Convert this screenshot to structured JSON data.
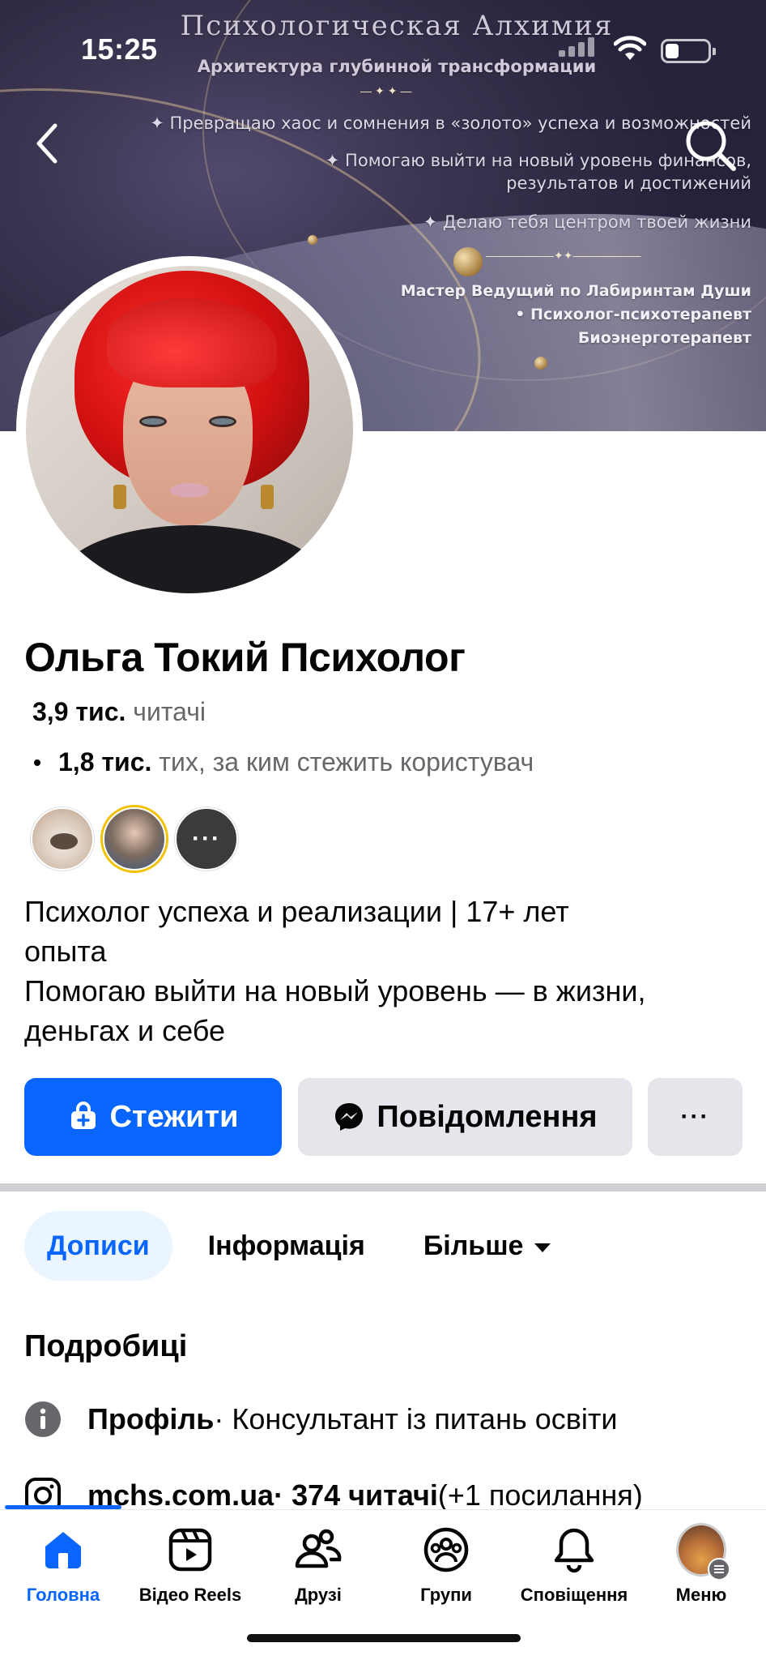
{
  "status_bar": {
    "time": "15:25"
  },
  "cover": {
    "title": "Психологическая Алхимия",
    "subtitle": "Архитектура глубинной трансформации",
    "lines": [
      "✦ Превращаю хаос и сомнения в «золото» успеха и возможностей",
      "✦ Помогаю выйти на новый уровень финансов,",
      "результатов и достижений",
      "✦ Делаю тебя центром твоей жизни"
    ],
    "roles": [
      "Мастер Ведущий по Лабиринтам Души",
      "• Психолог-психотерапевт",
      "Биоэнерготерапевт"
    ],
    "colors": {
      "background": "#2f2a45",
      "gold": "#d9b877"
    }
  },
  "profile": {
    "name": "Ольга Токий Психолог",
    "followers_count": "3,9 тис.",
    "followers_label": "читачі",
    "following_count": "1,8 тис.",
    "following_label": "тих, за ким стежить користувач",
    "follower_avatars": [
      "cat-avatar",
      "woman-avatar",
      "more"
    ],
    "more_avatars_label": "···",
    "bio": [
      "Психолог успеха и реализации | 17+ лет",
      "опыта",
      "Помогаю выйти на новый уровень — в жизни,",
      "деньгах и себе"
    ]
  },
  "actions": {
    "follow_label": "Стежити",
    "message_label": "Повідомлення",
    "more_label": "···"
  },
  "tabs": [
    {
      "label": "Дописи",
      "active": true
    },
    {
      "label": "Інформація",
      "active": false
    },
    {
      "label": "Більше",
      "active": false
    }
  ],
  "details": {
    "heading": "Подробиці",
    "profile_label": "Профіль",
    "profile_value": " · Консультант із питань освіти",
    "instagram_handle": "mchs.com.ua",
    "instagram_followers": " · 374 читачі",
    "instagram_more": " (+1 посилання)"
  },
  "bottom_nav": [
    {
      "label": "Головна",
      "icon": "home-icon",
      "active": true
    },
    {
      "label": "Відео Reels",
      "icon": "reels-icon",
      "active": false
    },
    {
      "label": "Друзі",
      "icon": "friends-icon",
      "active": false
    },
    {
      "label": "Групи",
      "icon": "groups-icon",
      "active": false
    },
    {
      "label": "Сповіщення",
      "icon": "bell-icon",
      "active": false
    },
    {
      "label": "Меню",
      "icon": "menu-avatar",
      "active": false
    }
  ],
  "colors": {
    "accent": "#0866ff",
    "button_gray": "#e4e6eb",
    "secondary_text": "#65676b",
    "active_tab_bg": "#ebf5ff"
  }
}
